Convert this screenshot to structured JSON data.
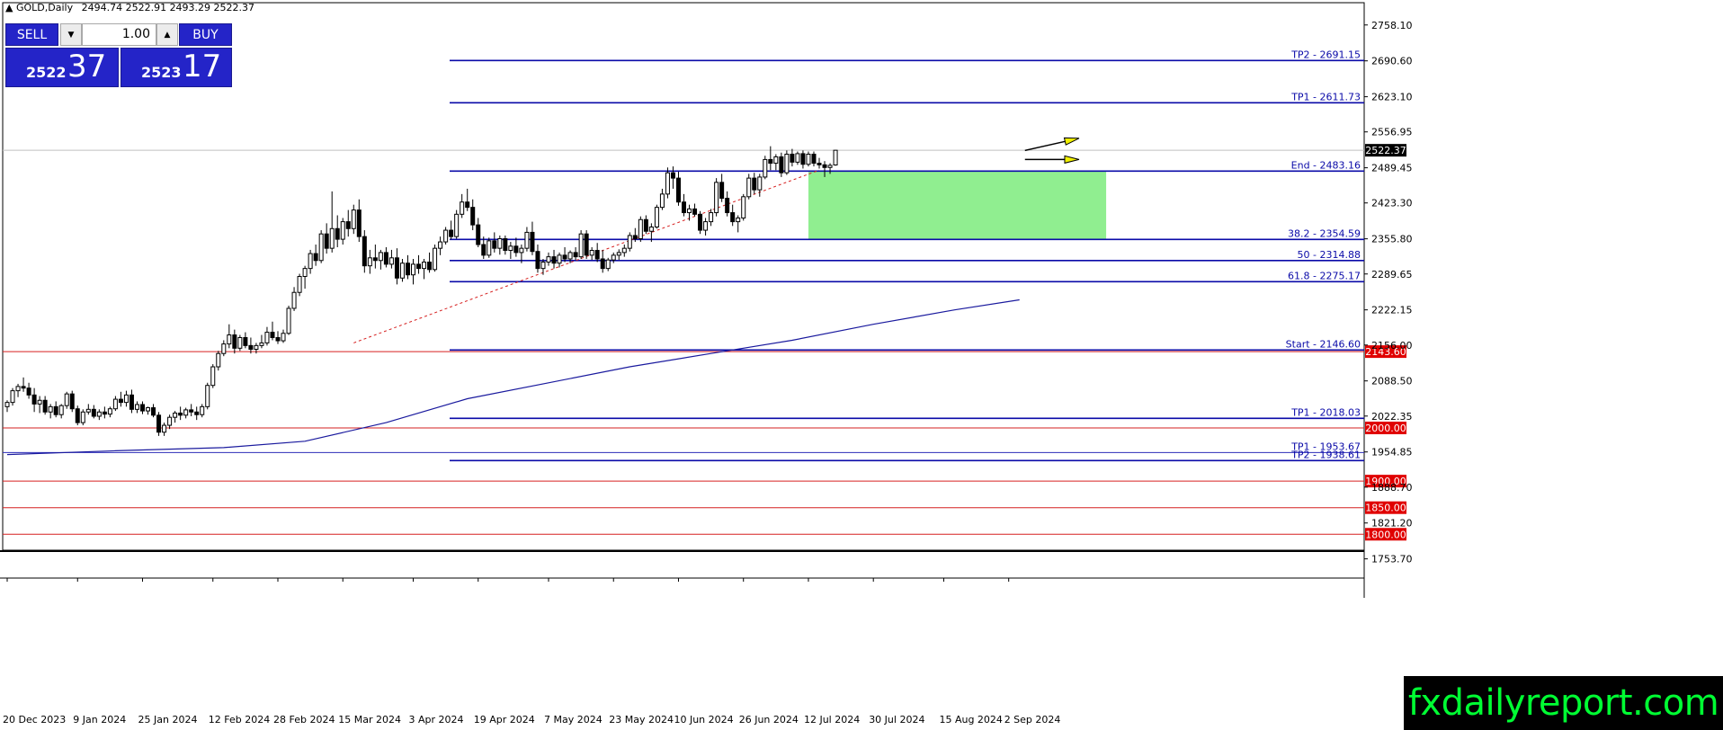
{
  "header": {
    "symbol": "GOLD,Daily",
    "ohlc": "2494.74 2522.91 2493.29 2522.37"
  },
  "trade_panel": {
    "sell_label": "SELL",
    "buy_label": "BUY",
    "lot_value": "1.00",
    "sell_price_small": "2522",
    "sell_price_big": "37",
    "buy_price_small": "2523",
    "buy_price_big": "17"
  },
  "brand": "fxdailyreport.com",
  "colors": {
    "level_line": "#0a0aa8",
    "round_line": "#d62020",
    "round_tag": "#e00000",
    "zone_fill": "#90ee90",
    "ma_line": "#1a1a9e",
    "arrow_fill": "#f0f000"
  },
  "chart_data": {
    "type": "candlestick",
    "ylim": [
      1770,
      2800
    ],
    "y_ticks": [
      "2758.10",
      "2690.60",
      "2623.10",
      "2556.95",
      "2489.45",
      "2423.30",
      "2355.80",
      "2289.65",
      "2222.15",
      "2156.00",
      "2088.50",
      "2022.35",
      "1954.85",
      "1888.70",
      "1821.20",
      "1753.70"
    ],
    "x_labels": [
      {
        "label": "20 Dec 2023",
        "index": 0
      },
      {
        "label": "9 Jan 2024",
        "index": 13
      },
      {
        "label": "25 Jan 2024",
        "index": 25
      },
      {
        "label": "12 Feb 2024",
        "index": 38
      },
      {
        "label": "28 Feb 2024",
        "index": 50
      },
      {
        "label": "15 Mar 2024",
        "index": 62
      },
      {
        "label": "3 Apr 2024",
        "index": 75
      },
      {
        "label": "19 Apr 2024",
        "index": 87
      },
      {
        "label": "7 May 2024",
        "index": 100
      },
      {
        "label": "23 May 2024",
        "index": 112
      },
      {
        "label": "10 Jun 2024",
        "index": 124
      },
      {
        "label": "26 Jun 2024",
        "index": 136
      },
      {
        "label": "12 Jul 2024",
        "index": 148
      },
      {
        "label": "30 Jul 2024",
        "index": 160
      },
      {
        "label": "15 Aug 2024",
        "index": 173
      },
      {
        "label": "2 Sep 2024",
        "index": 185
      }
    ],
    "current_price": {
      "value": 2522.37,
      "label": "2522.37"
    },
    "levels": [
      {
        "label": "TP2 - 2691.15",
        "value": 2691.15
      },
      {
        "label": "TP1 - 2611.73",
        "value": 2611.73
      },
      {
        "label": "End - 2483.16",
        "value": 2483.16
      },
      {
        "label": "38.2 - 2354.59",
        "value": 2354.59
      },
      {
        "label": "50 - 2314.88",
        "value": 2314.88
      },
      {
        "label": "61.8 - 2275.17",
        "value": 2275.17
      },
      {
        "label": "Start - 2146.60",
        "value": 2146.6
      },
      {
        "label": "TP1 - 2018.03",
        "value": 2018.03
      },
      {
        "label": "TP1 - 1953.67",
        "value": 1953.67
      },
      {
        "label": "TP2 - 1938.61",
        "value": 1938.61
      }
    ],
    "round_levels": [
      {
        "label": "2143.60",
        "value": 2143.6
      },
      {
        "label": "2000.00",
        "value": 2000.0
      },
      {
        "label": "1900.00",
        "value": 1900.0
      },
      {
        "label": "1850.00",
        "value": 1850.0
      },
      {
        "label": "1800.00",
        "value": 1800.0
      }
    ],
    "zone": {
      "from_index": 148,
      "to_index": 203,
      "low": 2354.59,
      "high": 2483.16
    },
    "trendline": {
      "from_index": 64,
      "from_value": 2160,
      "to_index": 150,
      "to_value": 2485
    },
    "moving_average": [
      {
        "index": 0,
        "value": 1950
      },
      {
        "index": 20,
        "value": 1957
      },
      {
        "index": 40,
        "value": 1963
      },
      {
        "index": 55,
        "value": 1975
      },
      {
        "index": 70,
        "value": 2010
      },
      {
        "index": 85,
        "value": 2055
      },
      {
        "index": 100,
        "value": 2085
      },
      {
        "index": 115,
        "value": 2115
      },
      {
        "index": 130,
        "value": 2140
      },
      {
        "index": 145,
        "value": 2165
      },
      {
        "index": 160,
        "value": 2195
      },
      {
        "index": 175,
        "value": 2222
      },
      {
        "index": 187,
        "value": 2241
      }
    ],
    "arrows": [
      {
        "index_from": 188,
        "value_from": 2522,
        "index_to": 198,
        "value_to": 2545
      },
      {
        "index_from": 188,
        "value_from": 2505,
        "index_to": 198,
        "value_to": 2505
      }
    ],
    "candles": [
      [
        2040,
        2052,
        2030,
        2048
      ],
      [
        2048,
        2075,
        2042,
        2070
      ],
      [
        2070,
        2083,
        2058,
        2078
      ],
      [
        2078,
        2095,
        2068,
        2075
      ],
      [
        2075,
        2085,
        2055,
        2062
      ],
      [
        2062,
        2075,
        2030,
        2045
      ],
      [
        2045,
        2060,
        2028,
        2052
      ],
      [
        2052,
        2060,
        2025,
        2030
      ],
      [
        2030,
        2045,
        2018,
        2040
      ],
      [
        2040,
        2050,
        2020,
        2025
      ],
      [
        2025,
        2045,
        2018,
        2042
      ],
      [
        2042,
        2068,
        2036,
        2064
      ],
      [
        2064,
        2070,
        2030,
        2036
      ],
      [
        2036,
        2042,
        2005,
        2010
      ],
      [
        2010,
        2035,
        2005,
        2030
      ],
      [
        2030,
        2045,
        2025,
        2035
      ],
      [
        2035,
        2043,
        2018,
        2022
      ],
      [
        2022,
        2035,
        2015,
        2030
      ],
      [
        2030,
        2040,
        2018,
        2026
      ],
      [
        2026,
        2040,
        2020,
        2036
      ],
      [
        2036,
        2060,
        2032,
        2054
      ],
      [
        2054,
        2068,
        2040,
        2048
      ],
      [
        2048,
        2070,
        2040,
        2062
      ],
      [
        2062,
        2072,
        2028,
        2035
      ],
      [
        2035,
        2050,
        2028,
        2044
      ],
      [
        2044,
        2050,
        2026,
        2032
      ],
      [
        2032,
        2040,
        2025,
        2038
      ],
      [
        2038,
        2045,
        2020,
        2024
      ],
      [
        2024,
        2030,
        1985,
        1992
      ],
      [
        1992,
        2010,
        1985,
        2005
      ],
      [
        2005,
        2025,
        1998,
        2020
      ],
      [
        2020,
        2032,
        2010,
        2028
      ],
      [
        2028,
        2040,
        2015,
        2024
      ],
      [
        2024,
        2038,
        2018,
        2034
      ],
      [
        2034,
        2045,
        2022,
        2030
      ],
      [
        2030,
        2040,
        2015,
        2025
      ],
      [
        2025,
        2045,
        2020,
        2040
      ],
      [
        2040,
        2085,
        2035,
        2080
      ],
      [
        2080,
        2120,
        2075,
        2115
      ],
      [
        2115,
        2145,
        2108,
        2140
      ],
      [
        2140,
        2165,
        2135,
        2158
      ],
      [
        2158,
        2195,
        2150,
        2175
      ],
      [
        2175,
        2185,
        2140,
        2150
      ],
      [
        2150,
        2175,
        2145,
        2170
      ],
      [
        2170,
        2180,
        2150,
        2155
      ],
      [
        2155,
        2170,
        2140,
        2148
      ],
      [
        2148,
        2160,
        2140,
        2155
      ],
      [
        2155,
        2175,
        2150,
        2160
      ],
      [
        2160,
        2190,
        2155,
        2180
      ],
      [
        2180,
        2200,
        2165,
        2170
      ],
      [
        2170,
        2182,
        2158,
        2164
      ],
      [
        2164,
        2185,
        2160,
        2178
      ],
      [
        2178,
        2230,
        2175,
        2225
      ],
      [
        2225,
        2265,
        2220,
        2255
      ],
      [
        2255,
        2290,
        2248,
        2285
      ],
      [
        2285,
        2305,
        2262,
        2300
      ],
      [
        2300,
        2335,
        2290,
        2328
      ],
      [
        2328,
        2345,
        2305,
        2315
      ],
      [
        2315,
        2372,
        2310,
        2365
      ],
      [
        2365,
        2385,
        2328,
        2338
      ],
      [
        2338,
        2445,
        2330,
        2375
      ],
      [
        2375,
        2400,
        2340,
        2355
      ],
      [
        2355,
        2395,
        2345,
        2388
      ],
      [
        2388,
        2410,
        2360,
        2375
      ],
      [
        2375,
        2420,
        2365,
        2410
      ],
      [
        2410,
        2430,
        2350,
        2360
      ],
      [
        2360,
        2372,
        2292,
        2305
      ],
      [
        2305,
        2335,
        2290,
        2320
      ],
      [
        2320,
        2345,
        2300,
        2315
      ],
      [
        2315,
        2335,
        2298,
        2330
      ],
      [
        2330,
        2340,
        2302,
        2308
      ],
      [
        2308,
        2335,
        2300,
        2320
      ],
      [
        2320,
        2338,
        2270,
        2282
      ],
      [
        2282,
        2318,
        2275,
        2310
      ],
      [
        2310,
        2325,
        2280,
        2288
      ],
      [
        2288,
        2318,
        2270,
        2308
      ],
      [
        2308,
        2325,
        2290,
        2300
      ],
      [
        2300,
        2318,
        2280,
        2312
      ],
      [
        2312,
        2330,
        2292,
        2298
      ],
      [
        2298,
        2345,
        2294,
        2338
      ],
      [
        2338,
        2360,
        2325,
        2350
      ],
      [
        2350,
        2378,
        2345,
        2372
      ],
      [
        2372,
        2390,
        2355,
        2360
      ],
      [
        2360,
        2410,
        2356,
        2402
      ],
      [
        2402,
        2440,
        2395,
        2425
      ],
      [
        2425,
        2450,
        2408,
        2415
      ],
      [
        2415,
        2430,
        2372,
        2382
      ],
      [
        2382,
        2395,
        2340,
        2345
      ],
      [
        2345,
        2360,
        2318,
        2325
      ],
      [
        2325,
        2358,
        2320,
        2352
      ],
      [
        2352,
        2368,
        2330,
        2338
      ],
      [
        2338,
        2362,
        2326,
        2356
      ],
      [
        2356,
        2362,
        2326,
        2334
      ],
      [
        2334,
        2350,
        2318,
        2342
      ],
      [
        2342,
        2358,
        2322,
        2330
      ],
      [
        2330,
        2345,
        2310,
        2338
      ],
      [
        2338,
        2378,
        2332,
        2368
      ],
      [
        2368,
        2388,
        2325,
        2332
      ],
      [
        2332,
        2345,
        2292,
        2300
      ],
      [
        2300,
        2318,
        2288,
        2312
      ],
      [
        2312,
        2330,
        2305,
        2322
      ],
      [
        2322,
        2335,
        2300,
        2310
      ],
      [
        2310,
        2330,
        2302,
        2325
      ],
      [
        2325,
        2340,
        2312,
        2318
      ],
      [
        2318,
        2334,
        2310,
        2330
      ],
      [
        2330,
        2340,
        2316,
        2322
      ],
      [
        2322,
        2372,
        2318,
        2365
      ],
      [
        2365,
        2372,
        2318,
        2325
      ],
      [
        2325,
        2340,
        2316,
        2334
      ],
      [
        2334,
        2348,
        2312,
        2318
      ],
      [
        2318,
        2335,
        2292,
        2300
      ],
      [
        2300,
        2320,
        2295,
        2316
      ],
      [
        2316,
        2330,
        2310,
        2325
      ],
      [
        2325,
        2336,
        2316,
        2330
      ],
      [
        2330,
        2345,
        2322,
        2338
      ],
      [
        2338,
        2368,
        2332,
        2362
      ],
      [
        2362,
        2376,
        2350,
        2356
      ],
      [
        2356,
        2398,
        2350,
        2392
      ],
      [
        2392,
        2400,
        2365,
        2370
      ],
      [
        2370,
        2385,
        2350,
        2378
      ],
      [
        2378,
        2420,
        2375,
        2415
      ],
      [
        2415,
        2450,
        2410,
        2440
      ],
      [
        2440,
        2490,
        2432,
        2480
      ],
      [
        2480,
        2492,
        2450,
        2470
      ],
      [
        2470,
        2482,
        2418,
        2425
      ],
      [
        2425,
        2440,
        2398,
        2405
      ],
      [
        2405,
        2420,
        2390,
        2412
      ],
      [
        2412,
        2422,
        2398,
        2402
      ],
      [
        2402,
        2408,
        2365,
        2372
      ],
      [
        2372,
        2395,
        2362,
        2388
      ],
      [
        2388,
        2412,
        2380,
        2405
      ],
      [
        2405,
        2470,
        2398,
        2462
      ],
      [
        2462,
        2478,
        2425,
        2432
      ],
      [
        2432,
        2445,
        2398,
        2405
      ],
      [
        2405,
        2420,
        2380,
        2388
      ],
      [
        2388,
        2400,
        2368,
        2395
      ],
      [
        2395,
        2440,
        2390,
        2435
      ],
      [
        2435,
        2478,
        2430,
        2470
      ],
      [
        2470,
        2480,
        2440,
        2448
      ],
      [
        2448,
        2478,
        2435,
        2472
      ],
      [
        2472,
        2512,
        2468,
        2505
      ],
      [
        2505,
        2530,
        2485,
        2498
      ],
      [
        2498,
        2515,
        2485,
        2510
      ],
      [
        2510,
        2518,
        2472,
        2480
      ],
      [
        2480,
        2522,
        2476,
        2515
      ],
      [
        2515,
        2525,
        2492,
        2500
      ],
      [
        2500,
        2520,
        2495,
        2516
      ],
      [
        2516,
        2522,
        2488,
        2496
      ],
      [
        2496,
        2520,
        2492,
        2515
      ],
      [
        2515,
        2520,
        2492,
        2498
      ],
      [
        2498,
        2508,
        2488,
        2495
      ],
      [
        2495,
        2502,
        2472,
        2490
      ],
      [
        2490,
        2498,
        2478,
        2494
      ],
      [
        2494.74,
        2522.91,
        2493.29,
        2522.37
      ]
    ]
  }
}
